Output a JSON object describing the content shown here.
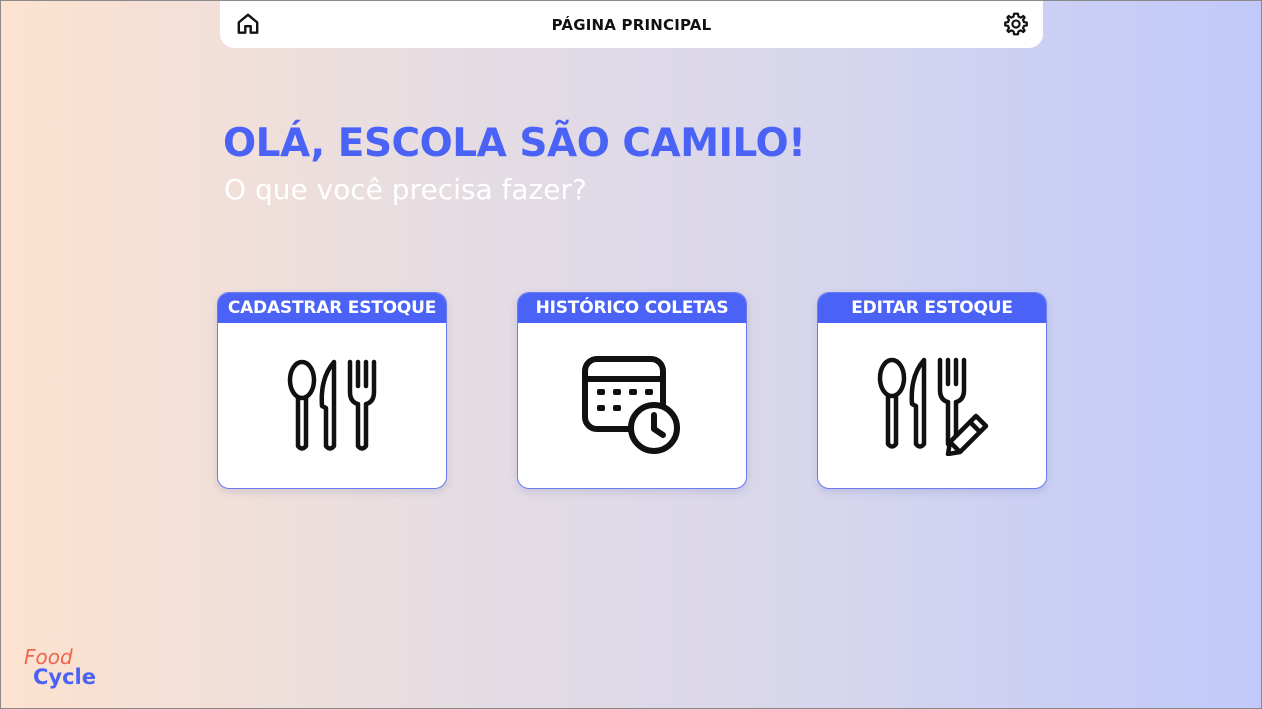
{
  "header": {
    "title": "PÁGINA PRINCIPAL",
    "home_icon": "home-icon",
    "settings_icon": "gear-icon"
  },
  "main": {
    "greeting": "OLÁ, ESCOLA SÃO CAMILO!",
    "subtitle": "O que você precisa fazer?"
  },
  "cards": [
    {
      "label": "CADASTRAR ESTOQUE",
      "icon": "cutlery-icon"
    },
    {
      "label": "HISTÓRICO COLETAS",
      "icon": "calendar-clock-icon"
    },
    {
      "label": "EDITAR ESTOQUE",
      "icon": "cutlery-edit-icon"
    }
  ],
  "brand": {
    "word1": "Food",
    "word2": "Cycle",
    "colors": {
      "primary": "#4a62f5",
      "accent": "#f0644a"
    }
  }
}
